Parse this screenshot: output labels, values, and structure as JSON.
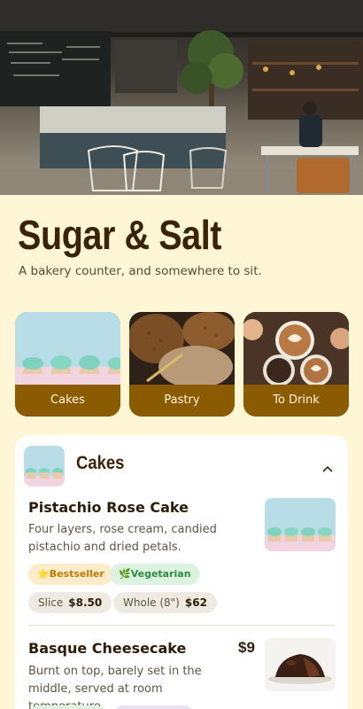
{
  "hero": {
    "image": "bakery cafe interior photo"
  },
  "header": {
    "title": "Sugar & Salt",
    "tagline": "A bakery counter, and somewhere to sit."
  },
  "categories": [
    {
      "label": "Cakes",
      "image": "cupcakes"
    },
    {
      "label": "Pastry",
      "image": "bread loaves"
    },
    {
      "label": "To Drink",
      "image": "latte art cups"
    }
  ],
  "section": {
    "title": "Cakes",
    "collapse_icon": "chevron-up-icon",
    "items": [
      {
        "name": "Pistachio Rose Cake",
        "description": "Four layers, rose cream, candied pistachio and dried petals.",
        "tags": [
          {
            "icon": "star-icon",
            "glyph": "⭐",
            "label": "Bestseller"
          },
          {
            "icon": "leaf-icon",
            "glyph": "🌿",
            "label": "Vegetarian"
          }
        ],
        "prices": [
          {
            "label": "Slice",
            "value": "$8.50"
          },
          {
            "label": "Whole (8\")",
            "value": "$62"
          }
        ]
      },
      {
        "name": "Basque Cheesecake",
        "price": "$9",
        "description": "Burnt on top, barely set in the middle, served at room temperature."
      }
    ]
  },
  "colors": {
    "background": "#fff6d6",
    "accent": "#8b5b00",
    "title": "#3b2406",
    "bestseller": "#c07a00",
    "vegetarian": "#2f8a43"
  }
}
